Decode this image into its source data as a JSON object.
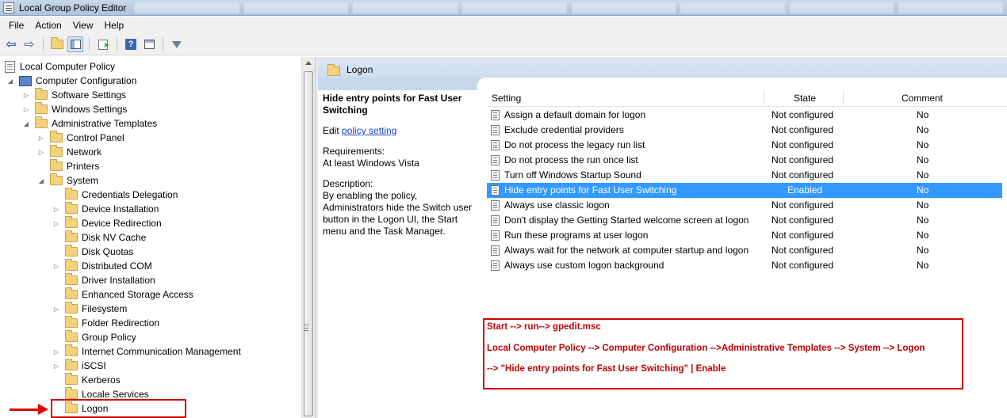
{
  "window": {
    "title": "Local Group Policy Editor"
  },
  "menu": [
    "File",
    "Action",
    "View",
    "Help"
  ],
  "toolbar": {
    "back_icon": "back-arrow-icon",
    "forward_icon": "forward-arrow-icon",
    "up_folder_icon": "up-folder-icon",
    "show_hide_tree_icon": "console-tree-icon",
    "export_icon": "export-list-icon",
    "help_icon": "help-icon",
    "properties_icon": "properties-icon",
    "filter_icon": "filter-icon"
  },
  "tree": {
    "root": "Local Computer Policy",
    "computer_configuration": "Computer Configuration",
    "software_settings": "Software Settings",
    "windows_settings": "Windows Settings",
    "administrative_templates": "Administrative Templates",
    "control_panel": "Control Panel",
    "network": "Network",
    "printers": "Printers",
    "system": "System",
    "system_children": [
      "Credentials Delegation",
      "Device Installation",
      "Device Redirection",
      "Disk NV Cache",
      "Disk Quotas",
      "Distributed COM",
      "Driver Installation",
      "Enhanced Storage Access",
      "Filesystem",
      "Folder Redirection",
      "Group Policy",
      "Internet Communication Management",
      "iSCSI",
      "Kerberos",
      "Locale Services",
      "Logon"
    ]
  },
  "right_panel": {
    "header_title": "Logon",
    "description": {
      "title": "Hide entry points for Fast User Switching",
      "edit_prefix": "Edit",
      "edit_link": "policy setting",
      "requirements_label": "Requirements:",
      "requirements_value": "At least Windows Vista",
      "description_label": "Description:",
      "description_text": "By enabling the policy, Administrators hide the Switch user button in the Logon UI, the Start menu and the Task Manager."
    },
    "table": {
      "columns": [
        "Setting",
        "State",
        "Comment"
      ],
      "rows": [
        {
          "setting": "Assign a default domain for logon",
          "state": "Not configured",
          "comment": "No"
        },
        {
          "setting": "Exclude credential providers",
          "state": "Not configured",
          "comment": "No"
        },
        {
          "setting": "Do not process the legacy run list",
          "state": "Not configured",
          "comment": "No"
        },
        {
          "setting": "Do not process the run once list",
          "state": "Not configured",
          "comment": "No"
        },
        {
          "setting": "Turn off Windows Startup Sound",
          "state": "Not configured",
          "comment": "No"
        },
        {
          "setting": "Hide entry points for Fast User Switching",
          "state": "Enabled",
          "comment": "No"
        },
        {
          "setting": "Always use classic logon",
          "state": "Not configured",
          "comment": "No"
        },
        {
          "setting": "Don't display the Getting Started welcome screen at logon",
          "state": "Not configured",
          "comment": "No"
        },
        {
          "setting": "Run these programs at user logon",
          "state": "Not configured",
          "comment": "No"
        },
        {
          "setting": "Always wait for the network at computer startup and logon",
          "state": "Not configured",
          "comment": "No"
        },
        {
          "setting": "Always use custom logon background",
          "state": "Not configured",
          "comment": "No"
        }
      ],
      "selected_index": 5
    }
  },
  "annotation": {
    "line1": "Start --> run--> gpedit.msc",
    "line2": "Local Computer Policy --> Computer Configuration -->Administrative Templates --> System --> Logon",
    "line3": "--> \"Hide entry points for Fast User Switching\" | Enable",
    "color": "#c00000"
  },
  "colors": {
    "selection": "#3399ff",
    "highlight_box": "#d00000",
    "header_bg": "#c7d8ec"
  }
}
